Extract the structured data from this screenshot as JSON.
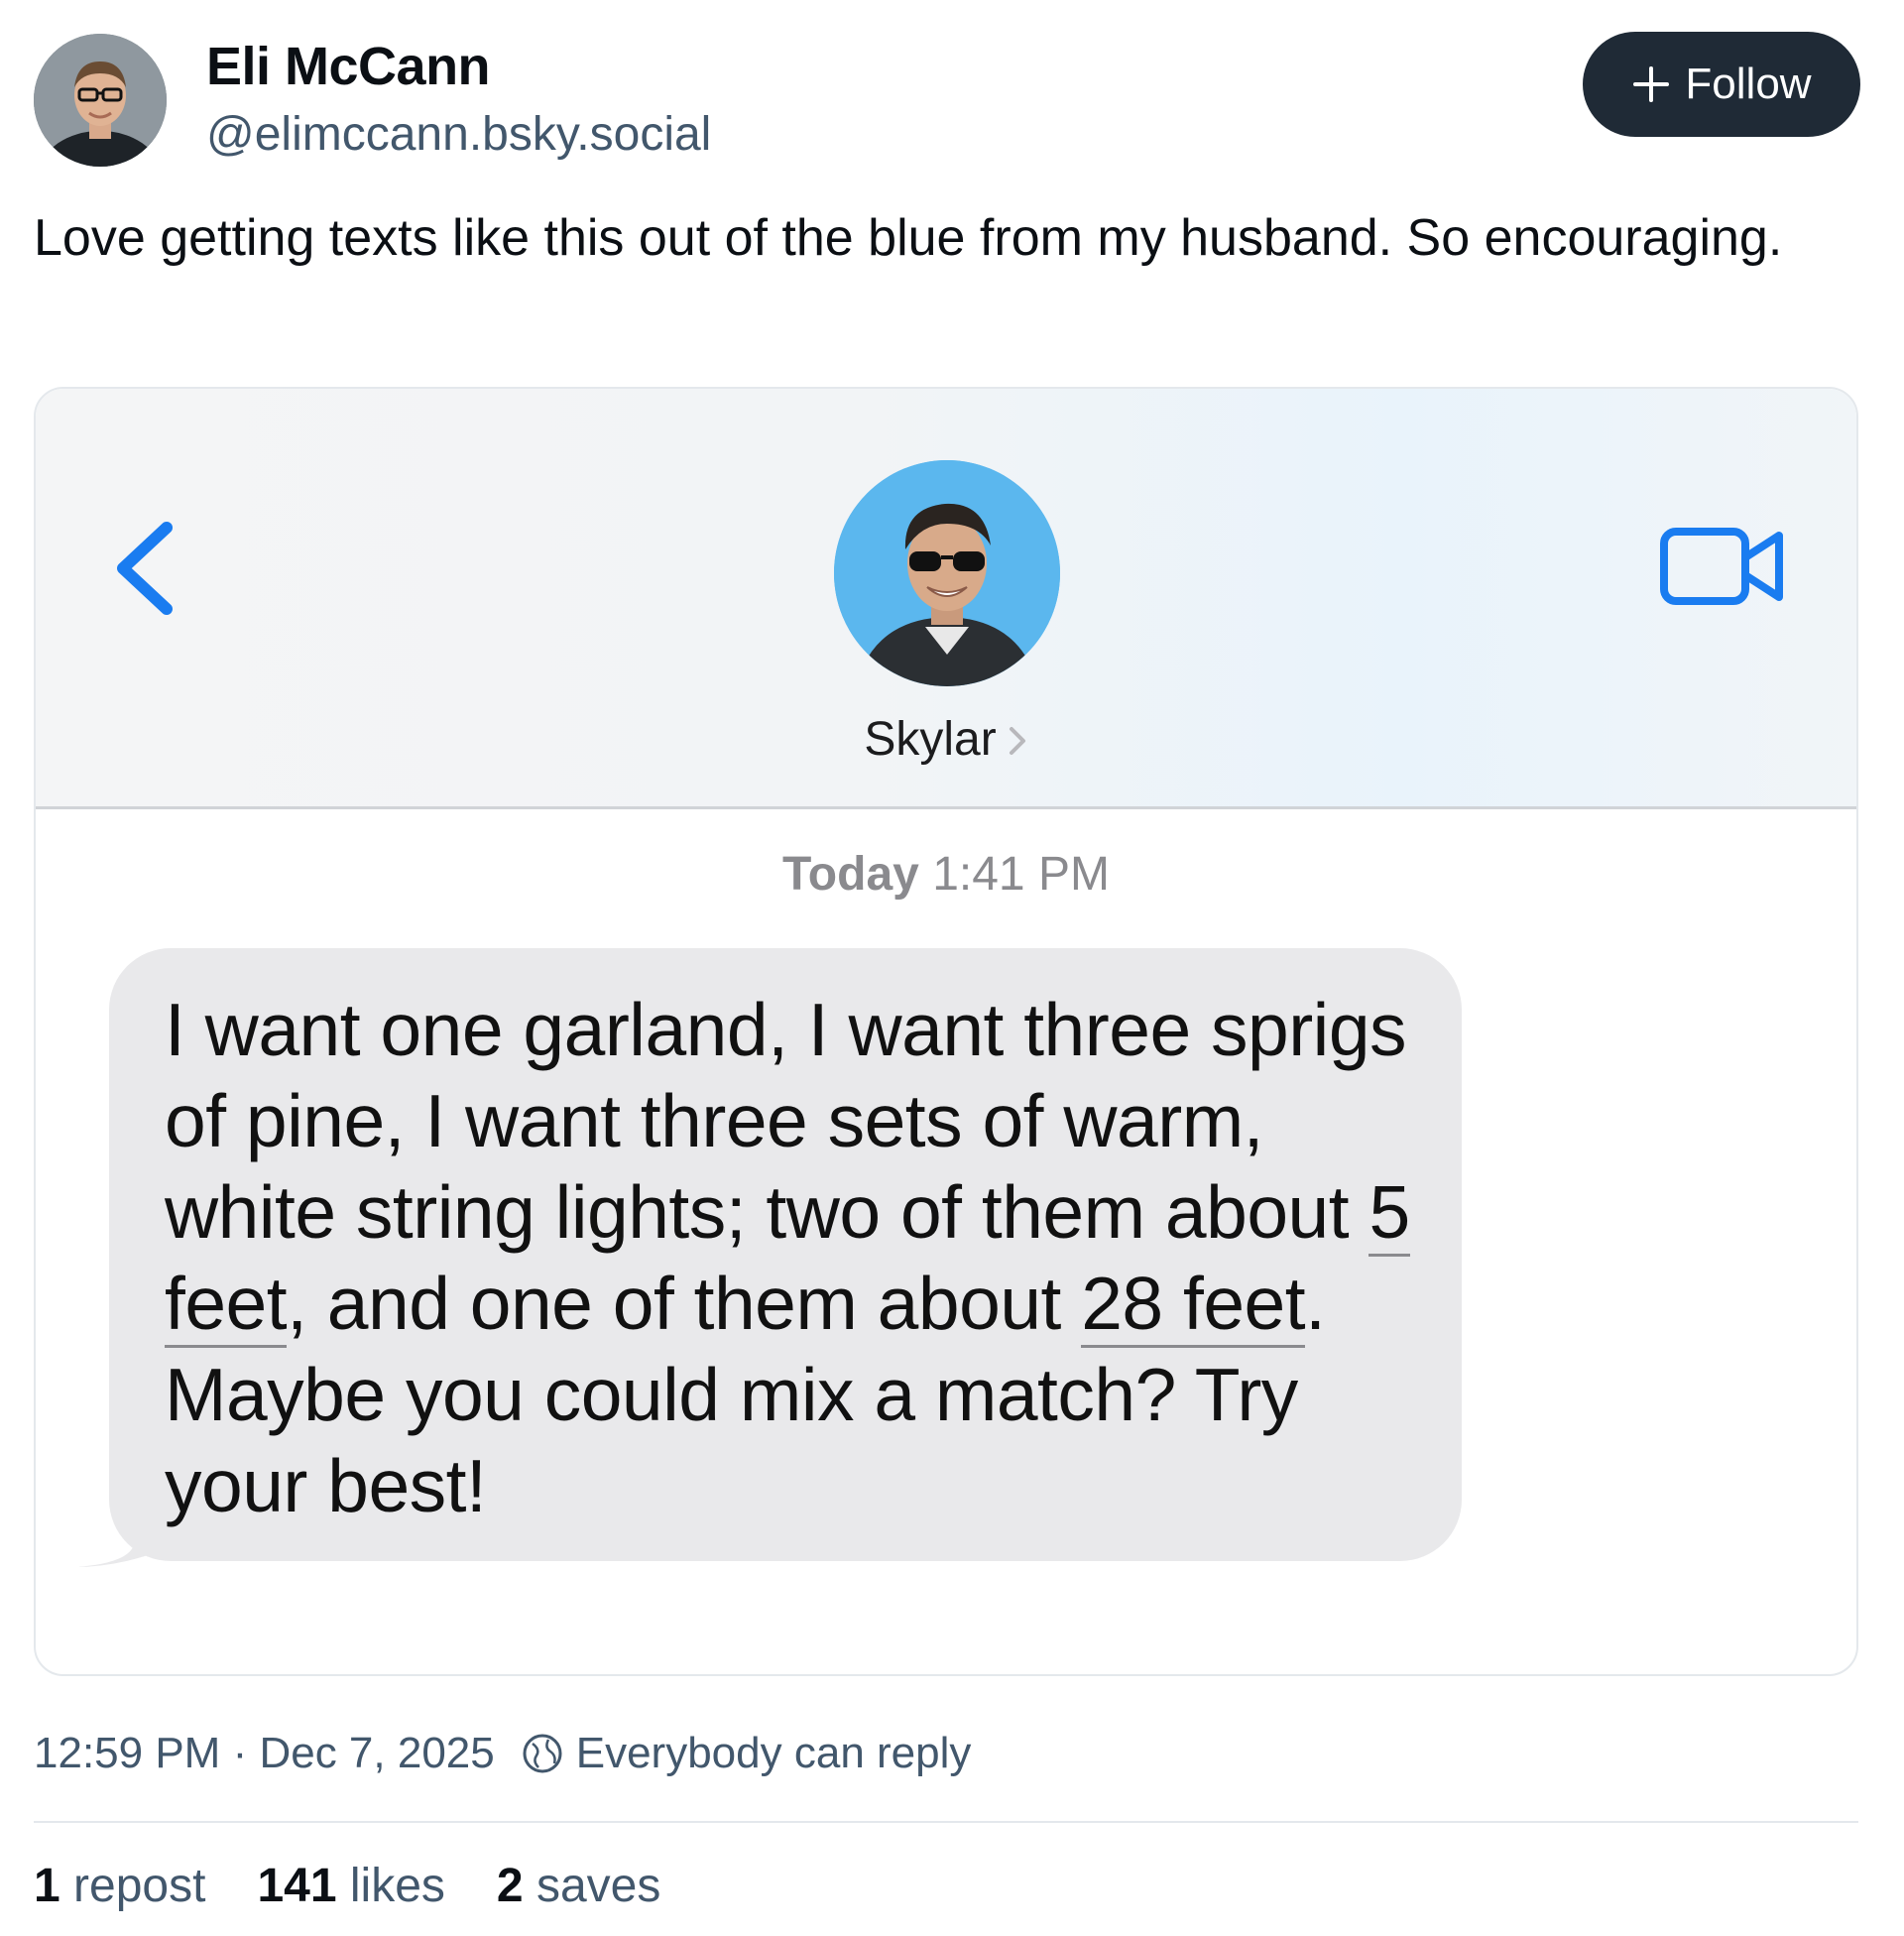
{
  "author": {
    "name": "Eli McCann",
    "handle": "@elimccann.bsky.social"
  },
  "follow_button": {
    "label": "Follow",
    "icon": "plus-icon"
  },
  "post": {
    "text": "Love getting texts like this out of the blue from my husband. So encouraging."
  },
  "embedded_screenshot": {
    "contact_name": "Skylar",
    "timestamp_label": "Today",
    "timestamp_time": "1:41 PM",
    "message": {
      "part1": "I want one garland, I want three sprigs of pine, I want three sets of warm, white string lights; two of them about ",
      "link1": "5 feet",
      "part2": ", and one of them about ",
      "link2": "28 feet",
      "part3": ". Maybe you could mix a match? Try your best!"
    },
    "icons": [
      "chevron-left-icon",
      "video-camera-icon",
      "chevron-right-icon"
    ],
    "accent_color": "#1a7cf0",
    "bubble_color": "#e9e9eb"
  },
  "meta": {
    "time": "12:59 PM",
    "separator": " · ",
    "date": "Dec 7, 2025",
    "reply_setting": "Everybody can reply",
    "icon": "globe-icon"
  },
  "stats": {
    "reposts_count": "1",
    "reposts_label": "repost",
    "likes_count": "141",
    "likes_label": "likes",
    "saves_count": "2",
    "saves_label": "saves"
  },
  "colors": {
    "follow_bg": "#1f2a36",
    "muted_text": "#42576c",
    "primary_text": "#0b0f14"
  }
}
